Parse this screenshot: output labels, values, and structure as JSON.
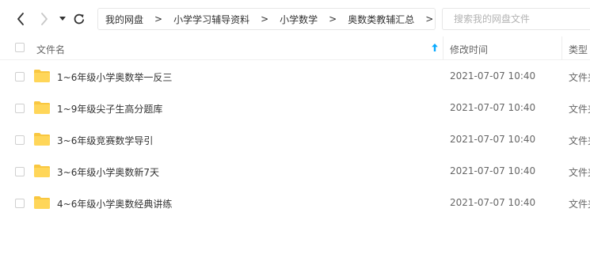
{
  "breadcrumb": [
    {
      "label": "我的网盘"
    },
    {
      "label": "小学学习辅导资料"
    },
    {
      "label": "小学数学"
    },
    {
      "label": "奥数类教辅汇总"
    }
  ],
  "breadcrumb_separator": ">",
  "search": {
    "placeholder": "搜索我的网盘文件"
  },
  "columns": {
    "name": "文件名",
    "modified": "修改时间",
    "type": "类型"
  },
  "files": [
    {
      "name": "1~6年级小学奥数举一反三",
      "modified": "2021-07-07 10:40",
      "type": "文件夹"
    },
    {
      "name": "1~9年级尖子生高分题库",
      "modified": "2021-07-07 10:40",
      "type": "文件夹"
    },
    {
      "name": "3~6年级竞赛数学导引",
      "modified": "2021-07-07 10:40",
      "type": "文件夹"
    },
    {
      "name": "3~6年级小学奥数新7天",
      "modified": "2021-07-07 10:40",
      "type": "文件夹"
    },
    {
      "name": "4~6年级小学奥数经典讲练",
      "modified": "2021-07-07 10:40",
      "type": "文件夹"
    }
  ],
  "colors": {
    "accent": "#09aaff",
    "folder": "#ffd659",
    "folder_tab": "#f9c740"
  },
  "icons": {
    "back": "chevron-left-icon",
    "forward": "chevron-right-icon",
    "dropdown": "caret-down-icon",
    "refresh": "refresh-icon",
    "sort": "arrow-up-icon",
    "folder": "folder-icon"
  }
}
